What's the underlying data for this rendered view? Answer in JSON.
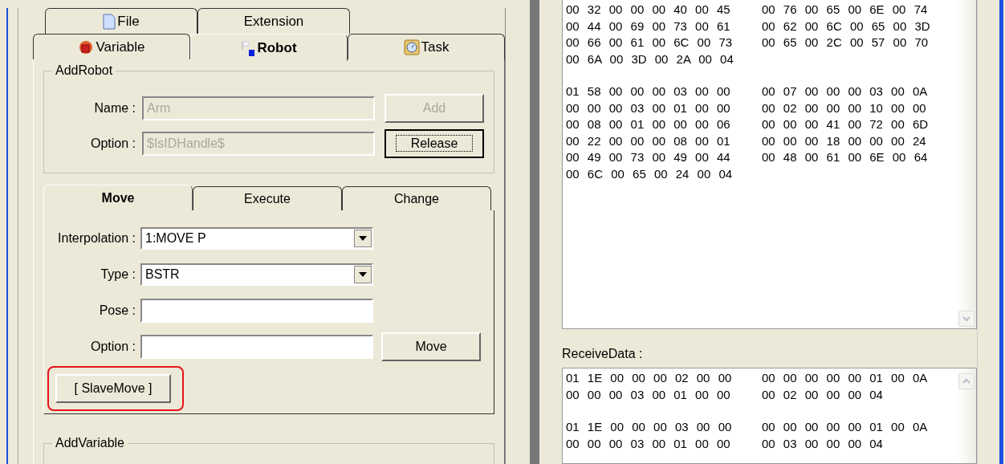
{
  "main_tabs": {
    "rows": [
      [
        {
          "label": "File",
          "selected": false
        },
        {
          "label": "Extension",
          "selected": false
        }
      ],
      [
        {
          "label": "Variable",
          "selected": false
        },
        {
          "label": "Robot",
          "selected": true
        },
        {
          "label": "Task",
          "selected": false
        }
      ]
    ]
  },
  "add_robot": {
    "title": "AddRobot",
    "fields": [
      {
        "label": "Name :",
        "value": "Arm",
        "disabled": true,
        "button": {
          "label": "Add",
          "disabled": true,
          "focused": false
        }
      },
      {
        "label": "Option :",
        "value": "$IsIDHandle$",
        "disabled": true,
        "button": {
          "label": "Release",
          "disabled": false,
          "focused": true
        }
      }
    ]
  },
  "robot_tabs": [
    {
      "label": "Move",
      "selected": true
    },
    {
      "label": "Execute",
      "selected": false
    },
    {
      "label": "Change",
      "selected": false
    }
  ],
  "move": {
    "fields": [
      {
        "kind": "dropdown",
        "label": "Interpolation :",
        "value": "1:MOVE P"
      },
      {
        "kind": "dropdown",
        "label": "Type :",
        "value": "BSTR"
      },
      {
        "kind": "text",
        "label": "Pose :"
      },
      {
        "kind": "text",
        "label": "Option :",
        "button": "Move"
      }
    ],
    "slave_button": {
      "label": "[ SlaveMove ]",
      "highlighted": true
    }
  },
  "add_variable": {
    "title": "AddVariable"
  },
  "send_data": {
    "blocks": [
      [
        [
          "00 32 00 00 00 40 00 45",
          "00 76 00 65 00 6E 00 74"
        ],
        [
          "00 44 00 69 00 73 00 61",
          "00 62 00 6C 00 65 00 3D"
        ],
        [
          "00 66 00 61 00 6C 00 73",
          "00 65 00 2C 00 57 00 70"
        ],
        [
          "00 6A 00 3D 00 2A 00 04"
        ]
      ],
      [
        [
          "01 58 00 00 00 03 00 00",
          "00 07 00 00 00 03 00 0A"
        ],
        [
          "00 00 00 03 00 01 00 00",
          "00 02 00 00 00 10 00 00"
        ],
        [
          "00 08 00 01 00 00 00 06",
          "00 00 00 41 00 72 00 6D"
        ],
        [
          "00 22 00 00 00 08 00 01",
          "00 00 00 18 00 00 00 24"
        ],
        [
          "00 49 00 73 00 49 00 44",
          "00 48 00 61 00 6E 00 64"
        ],
        [
          "00 6C 00 65 00 24 00 04"
        ]
      ]
    ]
  },
  "receive_data": {
    "label": "ReceiveData :",
    "blocks": [
      [
        [
          "01 1E 00 00 00 02 00 00",
          "00 00 00 00 00 01 00 0A"
        ],
        [
          "00 00 00 03 00 01 00 00",
          "00 02 00 00 00 04"
        ]
      ],
      [
        [
          "01 1E 00 00 00 03 00 00",
          "00 00 00 00 00 01 00 0A"
        ],
        [
          "00 00 00 03 00 01 00 00",
          "00 03 00 00 00 04"
        ]
      ]
    ]
  }
}
